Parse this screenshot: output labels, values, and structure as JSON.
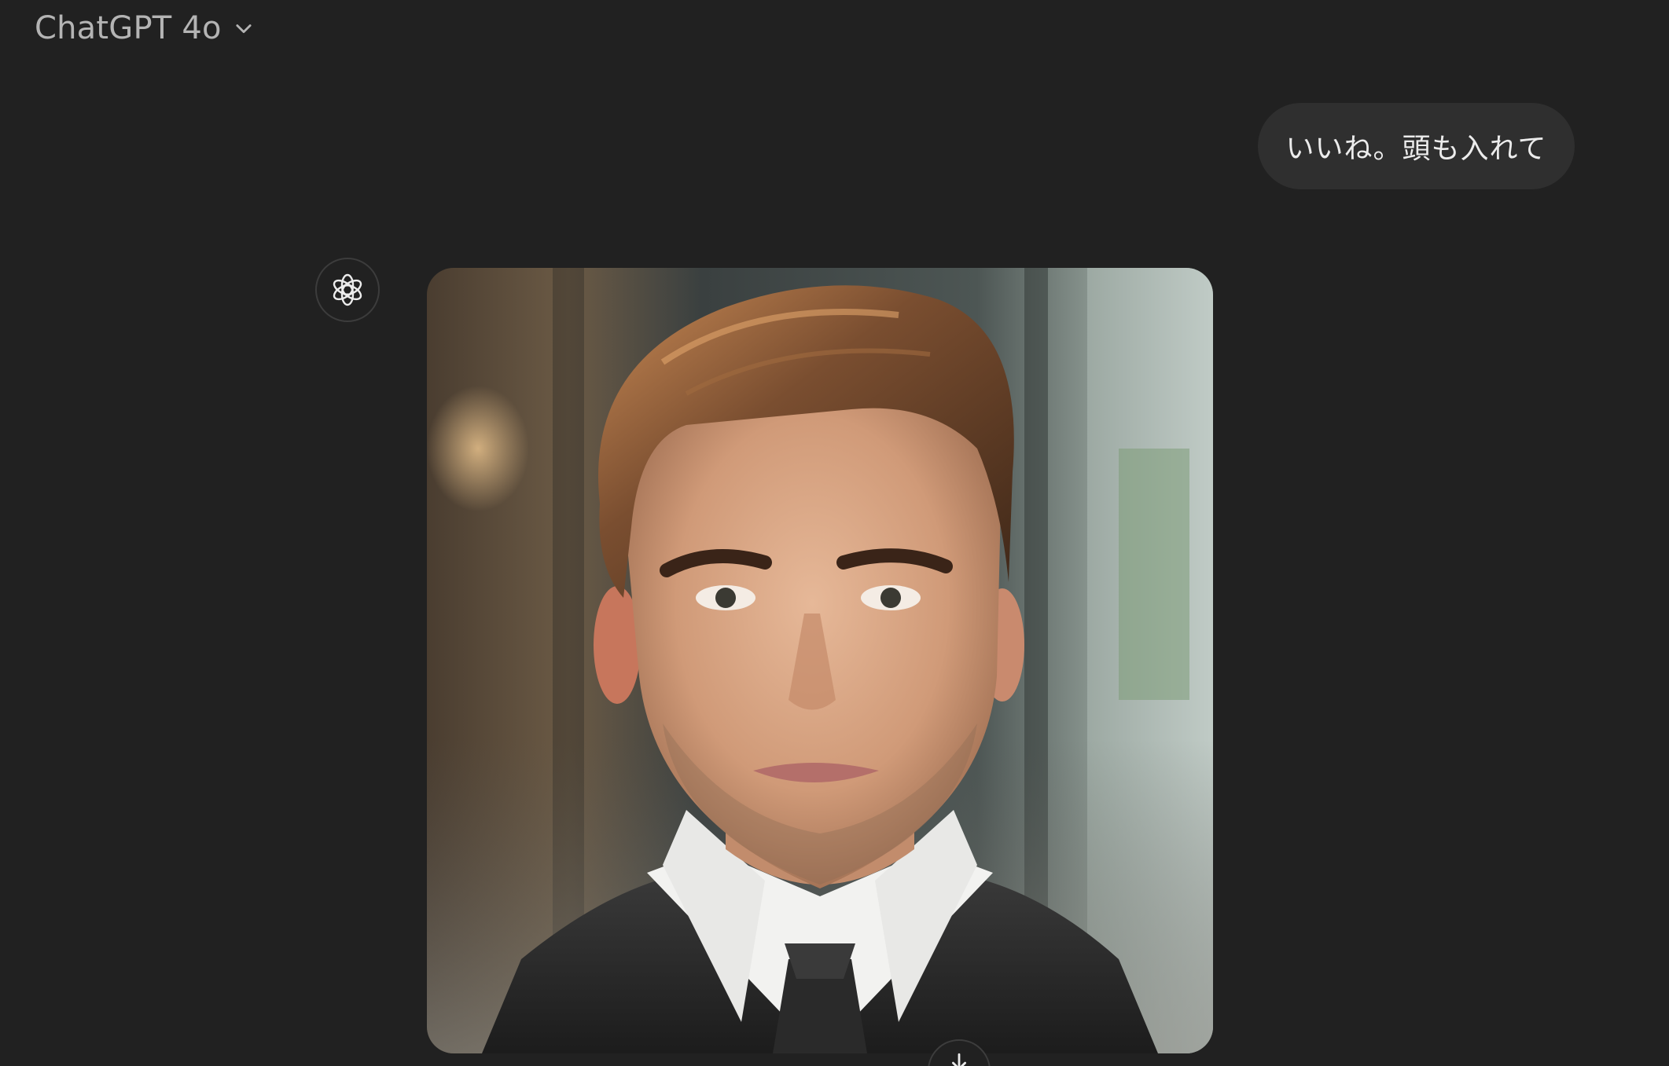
{
  "header": {
    "model_name": "ChatGPT 4o",
    "dropdown_icon": "chevron-down-icon"
  },
  "conversation": {
    "user_message": "いいね。頭も入れて",
    "assistant": {
      "avatar_icon": "openai-logo-icon",
      "generated_image": {
        "subject": "portrait of a man with swept-back brown hair in a dark suit and tie"
      }
    }
  },
  "scroll_button": {
    "icon": "arrow-down-icon"
  },
  "colors": {
    "background": "#212121",
    "bubble": "#2f2f2f",
    "header_text": "#b4b4b4",
    "text": "#ececec"
  }
}
